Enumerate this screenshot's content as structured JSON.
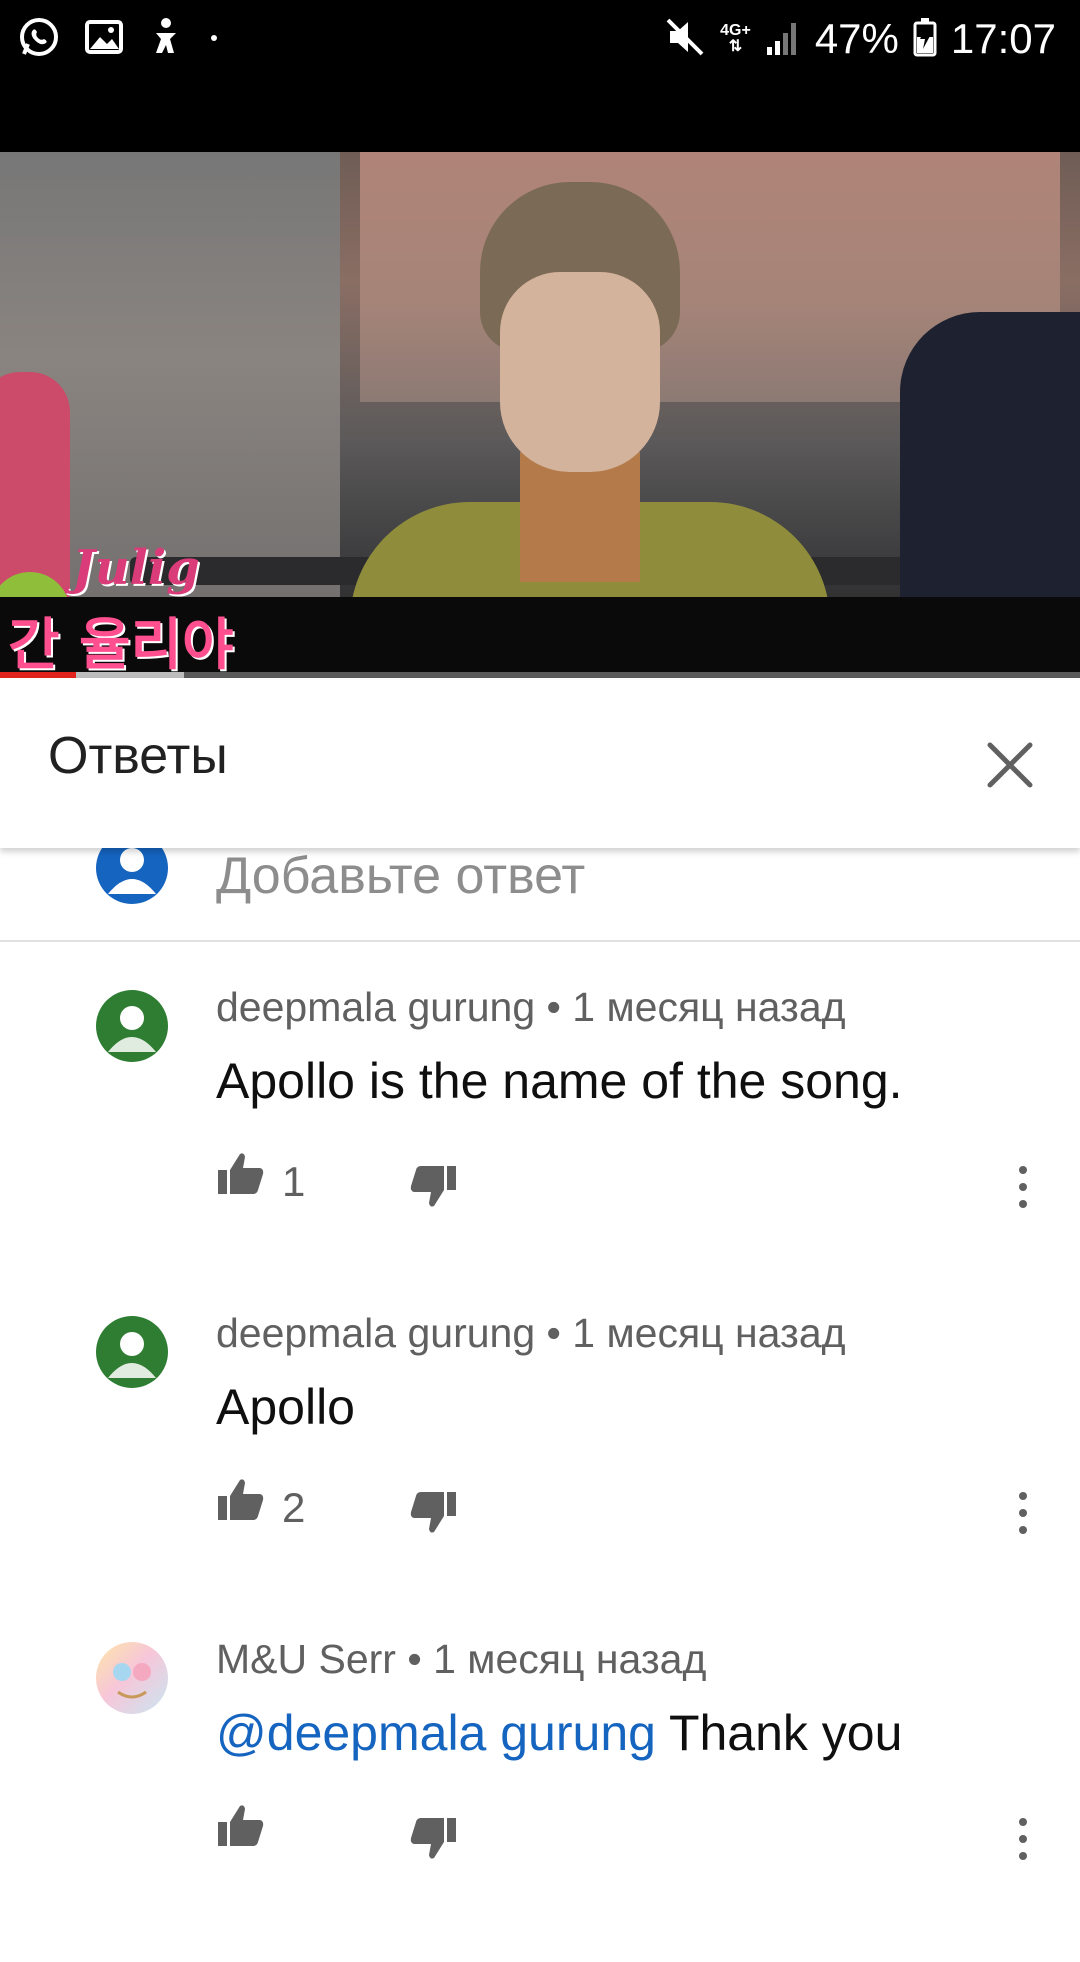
{
  "status_bar": {
    "network": "4G+",
    "battery": "47%",
    "time": "17:07",
    "icons": [
      "whatsapp-icon",
      "gallery-icon",
      "accessibility-icon",
      "dot-icon",
      "mute-icon",
      "signal-icon",
      "battery-charging-icon"
    ]
  },
  "video": {
    "caption_latin": "Julig",
    "caption_korean": "간 율리야",
    "progress_played": 0.07,
    "progress_buffered": 0.17
  },
  "header": {
    "title": "Ответы"
  },
  "add_reply": {
    "placeholder": "Добавьте ответ"
  },
  "comments": [
    {
      "author": "deepmala gurung",
      "time": "1 месяц назад",
      "mention": "",
      "text": "Apollo is the name of the song.",
      "likes": "1",
      "avatar_color": "#2e7d32"
    },
    {
      "author": "deepmala gurung",
      "time": "1 месяц назад",
      "mention": "",
      "text": "Apollo",
      "likes": "2",
      "avatar_color": "#2e7d32"
    },
    {
      "author": "M&U Serr",
      "time": "1 месяц назад",
      "mention": "@deepmala gurung",
      "text": " Thank you",
      "likes": "",
      "avatar_color": "#f7d9e3"
    }
  ],
  "colors": {
    "mention": "#1565c0",
    "progress": "#e1241b",
    "meta_text": "#606060"
  }
}
